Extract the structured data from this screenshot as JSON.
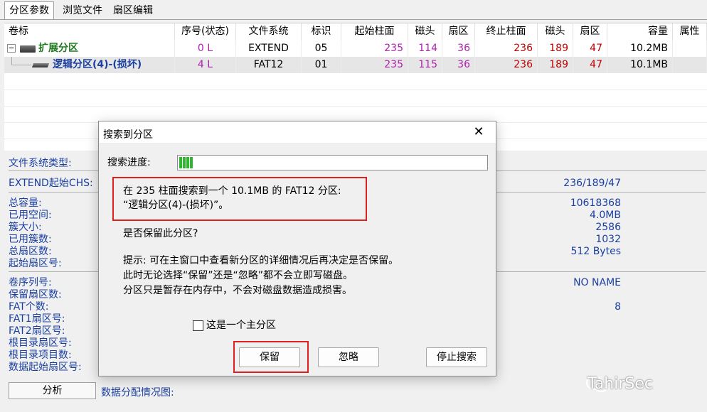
{
  "tabs": [
    "分区参数",
    "浏览文件",
    "扇区编辑"
  ],
  "table": {
    "headers": [
      "卷标",
      "序号(状态)",
      "文件系统",
      "标识",
      "起始柱面",
      "磁头",
      "扇区",
      "终止柱面",
      "磁头",
      "扇区",
      "容量",
      "属性"
    ],
    "rows": [
      {
        "expander": "−",
        "name": "扩展分区",
        "seq": "0 L",
        "fs": "EXTEND",
        "id": "05",
        "start_cyl": "235",
        "start_head": "114",
        "start_sec": "36",
        "end_cyl": "236",
        "end_head": "189",
        "end_sec": "47",
        "size": "10.2MB",
        "attr": ""
      },
      {
        "expander": "",
        "name": "逻辑分区(4)-(损坏)",
        "seq": "4 L",
        "fs": "FAT12",
        "id": "01",
        "start_cyl": "235",
        "start_head": "115",
        "start_sec": "36",
        "end_cyl": "236",
        "end_head": "189",
        "end_sec": "47",
        "size": "10.1MB",
        "attr": ""
      }
    ]
  },
  "details": {
    "labels": [
      "文件系统类型:",
      "EXTEND起始CHS:",
      "总容量:",
      "已用空间:",
      "簇大小:",
      "已用簇数:",
      "总扇区数:",
      "起始扇区号:",
      "卷序列号:",
      "保留扇区数:",
      "FAT个数:",
      "FAT1扇区号:",
      "FAT2扇区号:",
      "根目录扇区号:",
      "根目录项目数:",
      "数据起始扇区号:"
    ],
    "values": {
      "chs": "236/189/47",
      "total": "10618368",
      "used": "4.0MB",
      "cluster": "2586",
      "used_clusters": "1032",
      "sector_size": "512 Bytes",
      "volume_name": "NO NAME",
      "fat_count": "8"
    },
    "analyze_label": "分析",
    "distribution_label": "数据分配情况图:"
  },
  "dialog": {
    "title": "搜索到分区",
    "progress_label": "搜索进度:",
    "progress_fraction": 0.045,
    "found_line1": "在 235 柱面搜索到一个 10.1MB 的 FAT12 分区:",
    "found_line2": "“逻辑分区(4)-(损坏)”。",
    "question": "是否保留此分区?",
    "tip_line1": "提示: 可在主窗口中查看新分区的详细情况后再决定是否保留。",
    "tip_line2": "此时无论选择“保留”还是“忽略”都不会立即写磁盘。",
    "tip_line3": "分区只是暂存在内存中，不会对磁盘数据造成损害。",
    "checkbox_label": "这是一个主分区",
    "keep_button": "保留",
    "ignore_button": "忽略",
    "stop_button": "停止搜索"
  },
  "watermark": "TahirSec",
  "colors": {
    "purple": "#b020b0",
    "red": "#c00000",
    "green": "#1f7a1f",
    "blue": "#1a3fa0",
    "highlight": "#e02020",
    "progress": "#2fb52f"
  }
}
